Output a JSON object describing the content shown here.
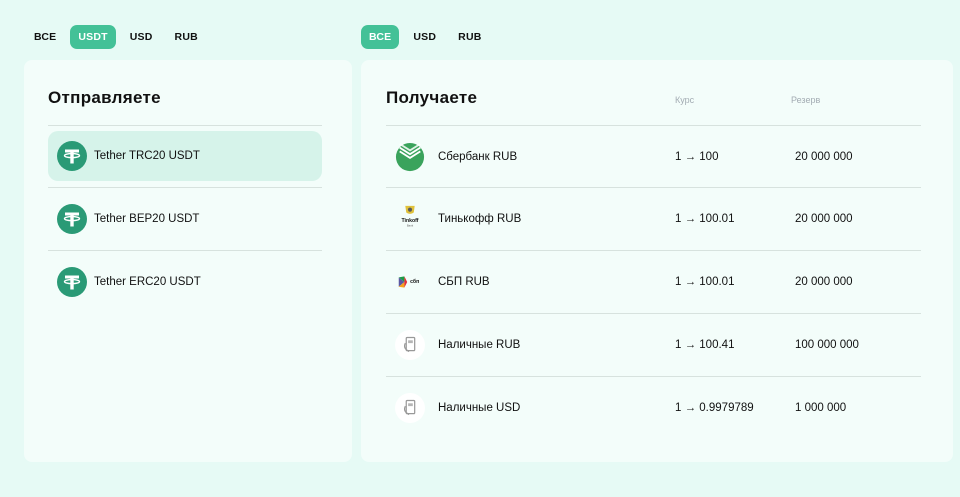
{
  "send_filters": [
    {
      "label": "ВСЕ",
      "active": false
    },
    {
      "label": "USDT",
      "active": true
    },
    {
      "label": "USD",
      "active": false
    },
    {
      "label": "RUB",
      "active": false
    }
  ],
  "receive_filters": [
    {
      "label": "ВСЕ",
      "active": true
    },
    {
      "label": "USD",
      "active": false
    },
    {
      "label": "RUB",
      "active": false
    }
  ],
  "send": {
    "title": "Отправляете",
    "items": [
      {
        "name": "Tether TRC20 USDT",
        "icon": "tether-icon",
        "selected": true
      },
      {
        "name": "Tether BEP20 USDT",
        "icon": "tether-icon",
        "selected": false
      },
      {
        "name": "Tether ERC20 USDT",
        "icon": "tether-icon",
        "selected": false
      }
    ]
  },
  "receive": {
    "title": "Получаете",
    "col_rate": "Курс",
    "col_reserve": "Резерв",
    "items": [
      {
        "name": "Сбербанк RUB",
        "icon": "sberbank-icon",
        "rate": "1 → 100",
        "reserve": "20 000 000"
      },
      {
        "name": "Тинькофф RUB",
        "icon": "tinkoff-icon",
        "logo_text": "Tinkoff",
        "logo_subtext": "Bank",
        "rate": "1 → 100.01",
        "reserve": "20 000 000"
      },
      {
        "name": "СБП RUB",
        "icon": "sbp-icon",
        "logo_text": "сбп",
        "rate": "1 → 100.01",
        "reserve": "20 000 000"
      },
      {
        "name": "Наличные RUB",
        "icon": "cash-icon",
        "rate": "1 → 100.41",
        "reserve": "100 000 000"
      },
      {
        "name": "Наличные USD",
        "icon": "cash-icon",
        "rate": "1 → 0.9979789",
        "reserve": "1 000 000"
      }
    ]
  },
  "colors": {
    "accent": "#43c197",
    "background": "#e6faf5",
    "panel": "#f3fdfa",
    "selected_row": "#d6f3ea",
    "tether": "#2a9a76"
  }
}
